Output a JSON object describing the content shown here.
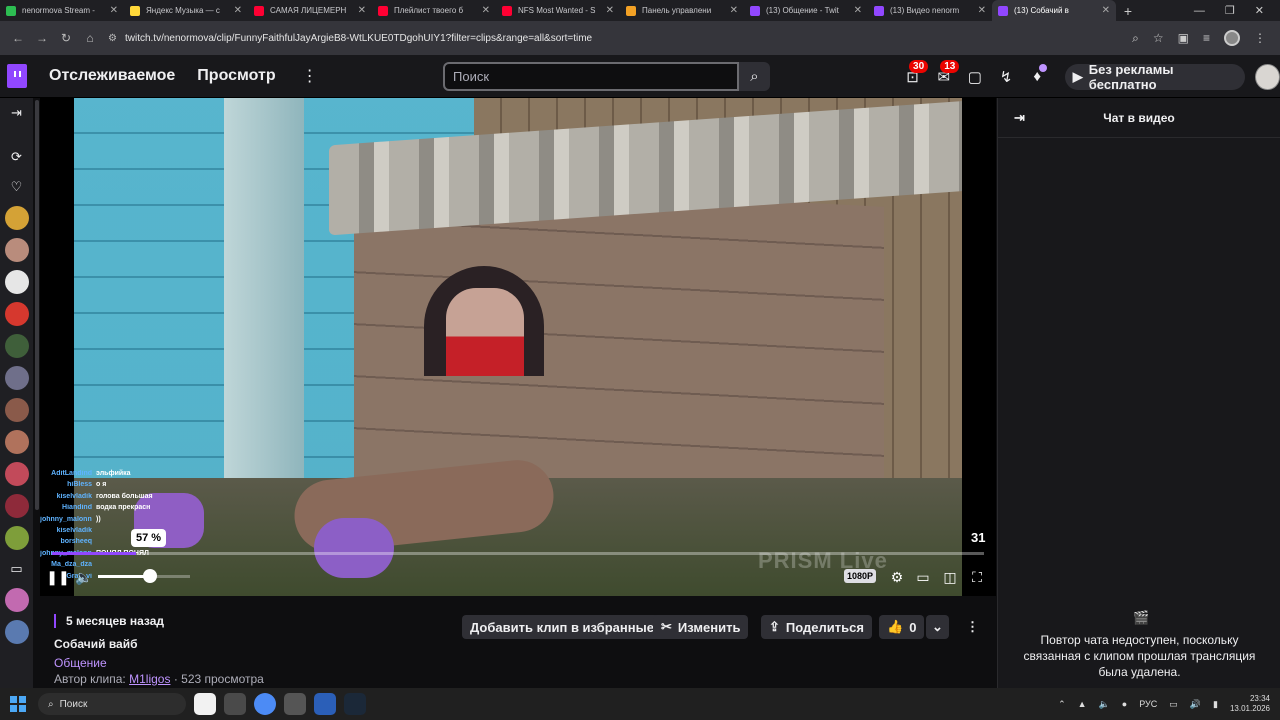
{
  "browser": {
    "tabs": [
      {
        "title": "nenormova Stream -",
        "color": "#2dbd52",
        "active": false
      },
      {
        "title": "Яндекс Музыка — с",
        "color": "#ffd83a",
        "active": false
      },
      {
        "title": "САМАЯ ЛИЦЕМЕРН",
        "color": "#ff0033",
        "active": false
      },
      {
        "title": "Плейлист твоего б",
        "color": "#ff0033",
        "active": false
      },
      {
        "title": "NFS Most Wanted - S",
        "color": "#ff0033",
        "active": false
      },
      {
        "title": "Панель управлени",
        "color": "#f2a125",
        "active": false
      },
      {
        "title": "(13) Общение - Twit",
        "color": "#9147ff",
        "active": false
      },
      {
        "title": "(13) Видео nenorm",
        "color": "#9147ff",
        "active": false
      },
      {
        "title": "(13) Собачий в",
        "color": "#9147ff",
        "active": true
      }
    ],
    "url": "twitch.tv/nenormova/clip/FunnyFaithfulJayArgieB8-WtLKUE0TDgohUIY1?filter=clips&range=all&sort=time"
  },
  "nav": {
    "following": "Отслеживаемое",
    "browse": "Просмотр",
    "search_placeholder": "Поиск",
    "inbox_count": "30",
    "whispers_count": "13",
    "turbo_label": "Без рекламы бесплатно"
  },
  "overlay_chat": [
    {
      "user": "AditLandind",
      "msg": "эльфийка"
    },
    {
      "user": "hiBless",
      "msg": "о я"
    },
    {
      "user": "kiselvladik",
      "msg": "голова большая"
    },
    {
      "user": "Hiandind",
      "msg": "водка прекрасн"
    },
    {
      "user": "johnny_malonny",
      "msg": "))"
    },
    {
      "user": "kiselvladik",
      "msg": ""
    },
    {
      "user": "borsheeq",
      "msg": ""
    },
    {
      "user": "johnny_malonny",
      "msg": "ПОНЯЛ ПОНЯЛ"
    },
    {
      "user": "Ma_dza_dza",
      "msg": ""
    },
    {
      "user": "Gray_vi",
      "msg": ""
    }
  ],
  "player": {
    "counter": "31",
    "volume_tooltip": "57 %",
    "volume_level": 0.57,
    "progress": 0.09,
    "quality": "1080P",
    "watermark": "PRISM Live"
  },
  "clip": {
    "time_ago": "5 месяцев назад",
    "title": "Собачий вайб",
    "category": "Общение",
    "author_label": "Автор клипа:",
    "author": "M1ligos",
    "views": "· 523 просмотра",
    "btn_favorite": "Добавить клип в избранные",
    "btn_edit": "Изменить",
    "btn_share": "Поделиться",
    "likes": "0"
  },
  "chat": {
    "header": "Чат в видео",
    "empty_message": "Повтор чата недоступен, поскольку связанная с клипом прошлая трансляция была удалена."
  },
  "taskbar": {
    "search": "Поиск",
    "lang": "РУС",
    "time": "23:34",
    "date": "13.01.2026"
  },
  "colors": {
    "accent": "#9147ff",
    "badge": "#eb0400"
  }
}
